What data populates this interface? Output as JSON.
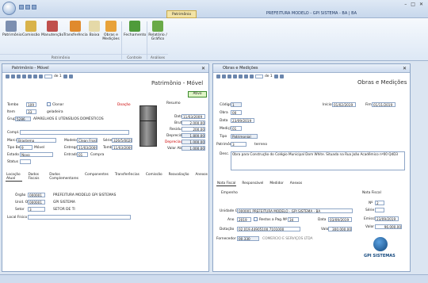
{
  "app": {
    "title": "PREFEITURA MODELO - GPI SISTEMA - BA | BA",
    "context_tab": "Patrimônio"
  },
  "ribbon": {
    "buttons": [
      "Patrimônio",
      "Comissão",
      "Manutenção",
      "Transferência",
      "Baixa",
      "Obras e Medições",
      "Fechamento",
      "Relatório / Gráfico"
    ],
    "groups": [
      "Patrimônio",
      "Controle",
      "Análises"
    ]
  },
  "left": {
    "title": "Patrimônio - Móvel",
    "big_title": "Patrimônio - Móvel",
    "pager": "de 1",
    "doacao": "Doação",
    "status_btn": "Ativo",
    "tombo_label": "Tombo",
    "tombo": "109",
    "clonar": "Clonar",
    "item_label": "Item",
    "item": "33",
    "item_desc": "geladeira",
    "grupo_label": "Grupo",
    "grupo": "5286",
    "grupo_desc": "APARELHOS E UTENSÍLIOS DOMÉSTICOS",
    "compl_label": "Compl.",
    "marca_label": "Marca",
    "marca": "Brastemp",
    "modelo_label": "Modelo",
    "modelo": "Clean Frost",
    "serie_label": "Série",
    "serie": "326/5/0026",
    "tipo_label": "Tipo Bem",
    "tipo": "9",
    "tipo_desc": "Móvel",
    "entrega_label": "Entrega",
    "entrega": "11/03/2009",
    "tombo2_label": "Tombo",
    "tombo2": "11/03/2009",
    "estado_label": "Estado",
    "estado": "Novo",
    "entrada_label": "Entrada",
    "entrada": "01",
    "entrada_desc": "Compra",
    "status_label": "Status",
    "valor": {
      "header": "Resumo",
      "data_label": "Data",
      "data": "11/03/2009",
      "bruto_label": "Bruto",
      "bruto": "2.000,00",
      "residual_label": "Residual",
      "residual": "200,00",
      "depreciavel_label": "Depreciável",
      "depreciavel": "1.800,00",
      "depreciacao_label": "Depreciação",
      "depreciacao": "1.000,00",
      "atual_label": "Valor Atual",
      "atual": "1.000,00"
    },
    "tabs": [
      "Locação Atual",
      "Dados Fiscais",
      "Dados Complementares",
      "Componentes",
      "Transferências",
      "Comissão",
      "Reavaliação",
      "Anexos"
    ],
    "orgao_label": "Órgão",
    "orgao": "000001",
    "orgao_desc": "PREFEITURA MODELO GPI SISTEMAS",
    "unid_label": "Unid. Orç.",
    "unid": "000001",
    "unid_desc": "GPI SISTEMA",
    "setor_label": "Setor",
    "setor": "3",
    "setor_desc": "SETOR DE TI",
    "local_label": "Local Físico"
  },
  "right": {
    "title": "Obras e Medições",
    "big_title": "Obras e Medições",
    "pager": "de 1",
    "codigo_label": "Código",
    "codigo": "1",
    "inicio_label": "Início",
    "inicio": "01/02/2019",
    "fim_label": "Fim",
    "fim": "01/11/2019",
    "obra_label": "Obra",
    "obra": "00",
    "data_label": "Data",
    "data": "23/09/2019",
    "medicao_label": "Medição",
    "medicao": "01",
    "tipo_label": "Tipo",
    "tipo": "Patrimonial",
    "patrimonio_label": "Patrimônio",
    "patrimonio": "3",
    "patrimonio_desc": "terreno",
    "desc_label": "Desc.",
    "desc": "Obra para Construção do Colégio Municipal Dom White. Situada na Rua João Acadêmico nº00 QdD3",
    "tabs": [
      "Nota Fiscal",
      "Responsável",
      "Medidor",
      "Anexos"
    ],
    "empenho": "Empenho",
    "unidade_label": "Unidade G.",
    "unidade": "000001",
    "unidade_desc": "PREFEITURA MODELO - GPI SISTEMA - BA",
    "ano_label": "Ano",
    "ano": "2019",
    "restos_label": "Restos a Pag.",
    "nr_label": "Nº",
    "nr": "34",
    "data2_label": "Data",
    "data2": "03/09/2019",
    "dotacao_label": "Dotação",
    "dotacao": "02.019.44905100.7101000",
    "valor_label": "Valor",
    "valor": "300.000,00",
    "fornecedor_label": "Fornecedor",
    "fornecedor": "00.330",
    "fornecedor_desc": "COMERCIO E SERVIÇOS LTDA",
    "nf": {
      "header": "Nota Fiscal",
      "nro_label": "Nº",
      "nro": "2",
      "serie_label": "Série",
      "serie": "",
      "emissao_label": "Emissão",
      "emissao": "23/09/2019",
      "valor_label": "Valor",
      "valor": "96.000,00"
    },
    "brand": "GPI SISTEMAS"
  }
}
